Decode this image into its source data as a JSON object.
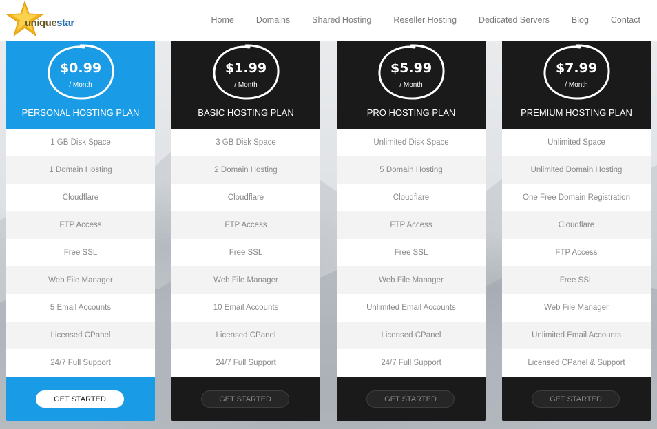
{
  "brand": {
    "logo_text_part1": "unique",
    "logo_text_part2": "star",
    "logo_star_color": "#f2b21c",
    "logo_icon": "star-icon"
  },
  "nav": {
    "items": [
      {
        "label": "Home"
      },
      {
        "label": "Domains"
      },
      {
        "label": "Shared Hosting"
      },
      {
        "label": "Reseller Hosting"
      },
      {
        "label": "Dedicated Servers"
      },
      {
        "label": "Blog"
      },
      {
        "label": "Contact"
      }
    ]
  },
  "colors": {
    "featured": "#1a9be5",
    "dark": "#1a1a1a"
  },
  "plans": [
    {
      "price": "$0.99",
      "period": "/ Month",
      "name": "PERSONAL HOSTING PLAN",
      "cta": "GET STARTED",
      "features": [
        "1 GB Disk Space",
        "1 Domain Hosting",
        "Cloudflare",
        "FTP Access",
        "Free SSL",
        "Web File Manager",
        "5 Email Accounts",
        "Licensed CPanel",
        "24/7 Full Support"
      ]
    },
    {
      "price": "$1.99",
      "period": "/ Month",
      "name": "BASIC HOSTING PLAN",
      "cta": "GET STARTED",
      "features": [
        "3 GB Disk Space",
        "2 Domain Hosting",
        "Cloudflare",
        "FTP Access",
        "Free SSL",
        "Web File Manager",
        "10 Email Accounts",
        "Licensed CPanel",
        "24/7 Full Support"
      ]
    },
    {
      "price": "$5.99",
      "period": "/ Month",
      "name": "PRO HOSTING PLAN",
      "cta": "GET STARTED",
      "features": [
        "Unlimited Disk Space",
        "5 Domain Hosting",
        "Cloudflare",
        "FTP Access",
        "Free SSL",
        "Web File Manager",
        "Unlimited Email Accounts",
        "Licensed CPanel",
        "24/7 Full Support"
      ]
    },
    {
      "price": "$7.99",
      "period": "/ Month",
      "name": "PREMIUM HOSTING PLAN",
      "cta": "GET STARTED",
      "features": [
        "Unlimited Space",
        "Unlimited Domain Hosting",
        "One Free Domain Registration",
        "Cloudflare",
        "FTP Access",
        "Free SSL",
        "Web File Manager",
        "Unlimited Email Accounts",
        "Licensed CPanel & Support"
      ]
    }
  ]
}
